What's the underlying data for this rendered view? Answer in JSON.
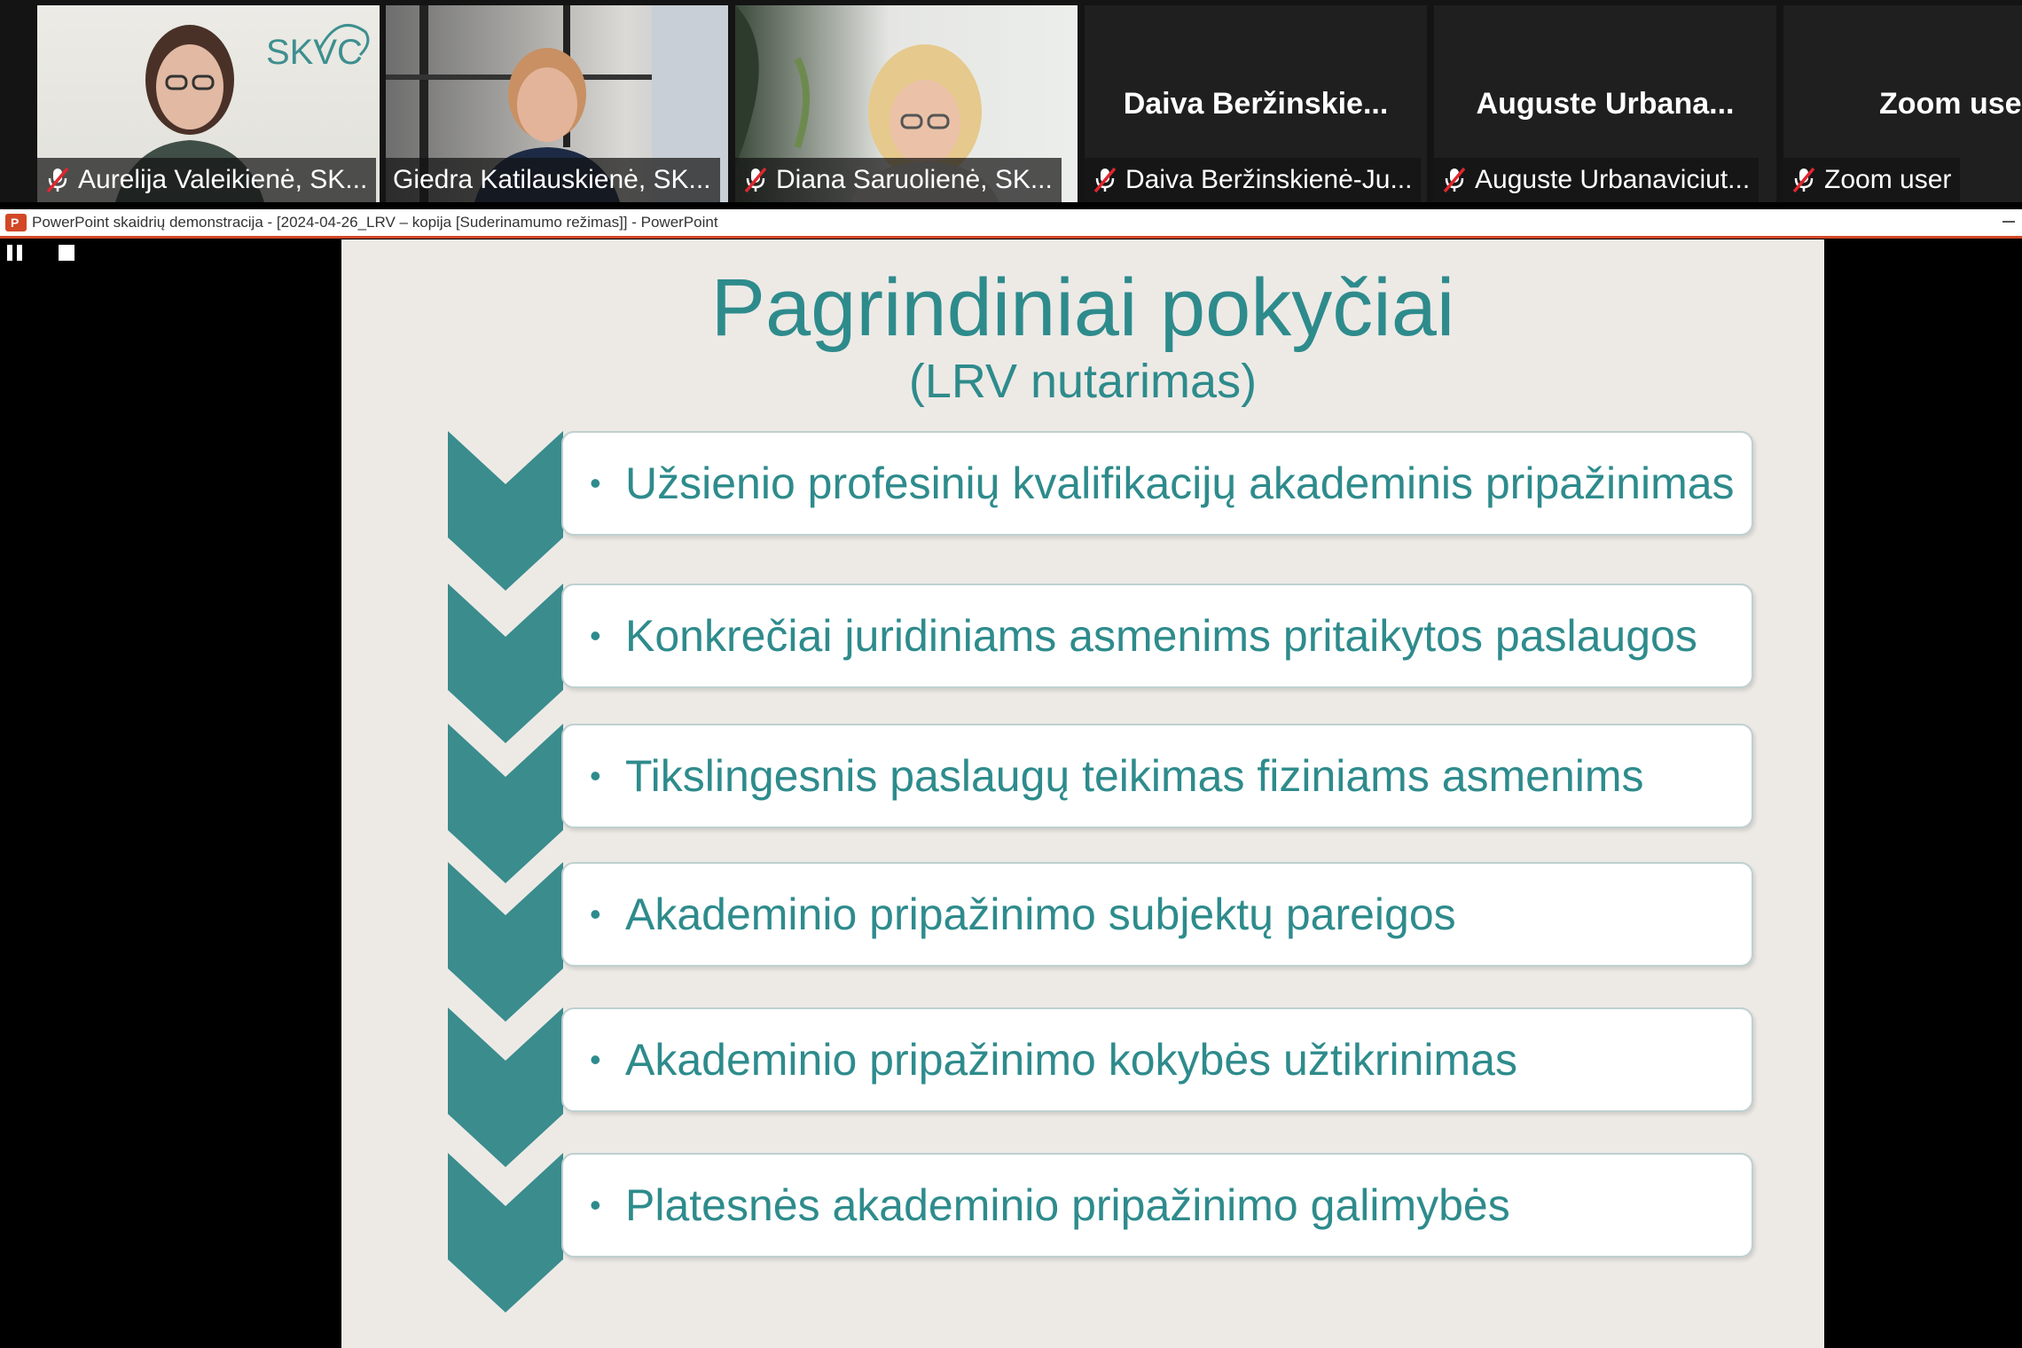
{
  "participants": [
    {
      "label": "Aurelija Valeikienė, SK...",
      "muted": true,
      "video": true,
      "logo_text": "SKVC"
    },
    {
      "label": "Giedra Katilauskienė, SK...",
      "muted": false,
      "video": true,
      "active": true
    },
    {
      "label": "Diana Saruolienė, SK...",
      "muted": true,
      "video": true
    },
    {
      "display_name": "Daiva  Beržinskie...",
      "label": "Daiva Beržinskienė-Ju...",
      "muted": true,
      "video": false
    },
    {
      "display_name": "Auguste  Urbana...",
      "label": "Auguste Urbanaviciut...",
      "muted": true,
      "video": false
    },
    {
      "display_name": "Zoom  user",
      "label": "Zoom user",
      "muted": true,
      "video": false
    }
  ],
  "window": {
    "title": "PowerPoint skaidrių demonstracija - [2024-04-26_LRV – kopija [Suderinamumo režimas]] - PowerPoint"
  },
  "slide": {
    "title": "Pagrindiniai pokyčiai",
    "subtitle": "(LRV nutarimas)",
    "items": [
      "Užsienio profesinių kvalifikacijų akademinis pripažinimas",
      "Konkrečiai juridiniams asmenims pritaikytos paslaugos",
      "Tikslingesnis paslaugų teikimas fiziniams asmenims",
      "Akademinio pripažinimo subjektų pareigos",
      "Akademinio pripažinimo kokybės užtikrinimas",
      "Platesnės akademinio pripažinimo galimybės"
    ],
    "bullet": "•",
    "colors": {
      "accent": "#2e8b8c",
      "chevron": "#3a8c8d",
      "background": "#edeae6"
    }
  },
  "icons": {
    "mic_muted": "mic-muted-icon",
    "powerpoint": "powerpoint-icon",
    "pause": "pause-icon",
    "stop": "stop-icon"
  }
}
